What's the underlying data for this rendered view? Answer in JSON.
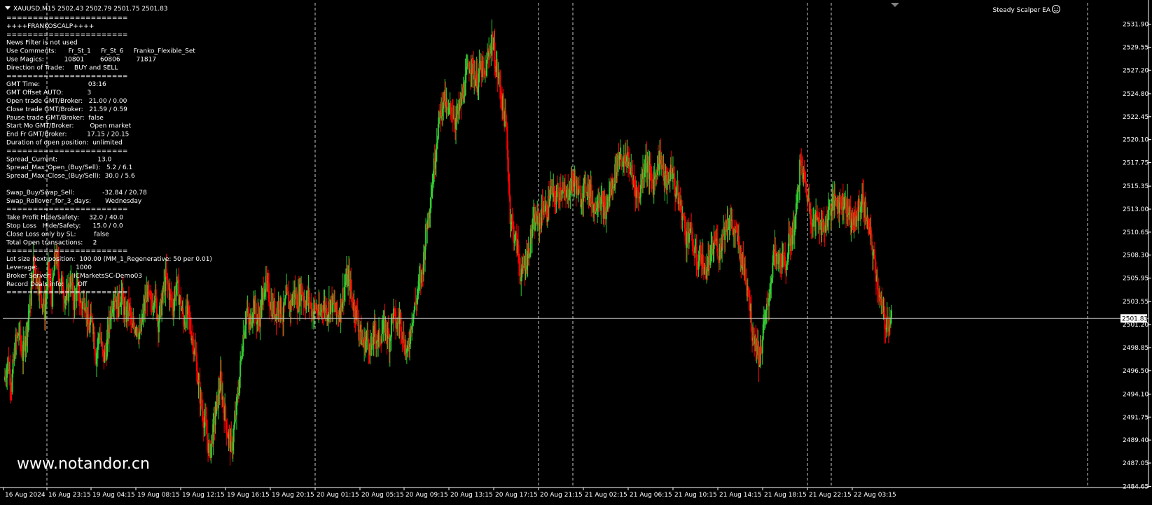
{
  "header": {
    "symbol_line": "XAUUSD,M15  2502.43 2502.79 2501.75 2501.83",
    "ea_name": "Steady Scalper EA",
    "ea_icon": "smiley-icon"
  },
  "info_panel": [
    "=======================",
    "++++FRANKOSCALP++++",
    "=======================",
    "News Filter is not used",
    "Use Comments:      Fr_St_1     Fr_St_6     Franko_Flexible_Set",
    "Use Magics:          10801        60806        71817",
    "Direction of Trade:     BUY and SELL",
    "=======================",
    "GMT Time:                        03:16",
    "GMT Offset AUTO:            3",
    "Open trade GMT/Broker:   21.00 / 0.00",
    "Close trade GMT/Broker:   21.59 / 0.59",
    "Pause trade GMT/Broker:  false",
    "Start Mo GMT/Broker:        Open market",
    "End Fr GMT/Broker:          17.15 / 20.15",
    "Duration of open position:  unlimited",
    "=======================",
    "Spread_Current:                    13.0",
    "Spread_Max_Open_(Buy/Sell):   5.2 / 6.1",
    "Spread_Max_Close_(Buy/Sell):  30.0 / 5.6",
    "",
    "Swap_Buy/Swap_Sell:              -32.84 / 20.78",
    "Swap_Rollover_for_3_days:       Wednesday",
    "=======================",
    "Take Profit Hide/Safety:     32.0 / 40.0",
    "Stop Loss   Hide/Safety:      15.0 / 0.0",
    "Close Loss only by SL:         false",
    "Total Open transactions:     2",
    "=======================",
    "Lot size next position:  100.00 (MM_1_Regenerative: 50 per 0.01)",
    "Leverage:                   1000",
    "Broker Server:           ICMarketsSC-Demo03",
    "Record Deals info:       Off",
    "======================="
  ],
  "watermark": "www.notandor.cn",
  "colors": {
    "background": "#000000",
    "bull": "#32CD32",
    "bear": "#FF0000",
    "grid": "#C0C0C0",
    "text": "#FFFFFF",
    "price_line": "#C0C0C0"
  },
  "chart_data": {
    "type": "candlestick",
    "symbol": "XAUUSD",
    "timeframe": "M15",
    "ylim": [
      2484.55,
      2532.8
    ],
    "price_ticks": [
      "2531.90",
      "2529.55",
      "2527.20",
      "2524.80",
      "2522.45",
      "2520.10",
      "2517.75",
      "2515.35",
      "2513.00",
      "2510.65",
      "2508.30",
      "2505.95",
      "2503.55",
      "2501.20",
      "2498.85",
      "2496.50",
      "2494.10",
      "2491.75",
      "2489.40",
      "2487.05",
      "2484.65"
    ],
    "current_price": "2501.83",
    "time_ticks": [
      "16 Aug 2024",
      "16 Aug 23:15",
      "19 Aug 04:15",
      "19 Aug 08:15",
      "19 Aug 12:15",
      "19 Aug 16:15",
      "19 Aug 20:15",
      "20 Aug 01:15",
      "20 Aug 05:15",
      "20 Aug 09:15",
      "20 Aug 13:15",
      "20 Aug 17:15",
      "20 Aug 21:15",
      "21 Aug 02:15",
      "21 Aug 06:15",
      "21 Aug 10:15",
      "21 Aug 14:15",
      "21 Aug 18:15",
      "21 Aug 22:15",
      "22 Aug 03:15"
    ],
    "day_separators": [
      "16 Aug 23:15",
      "20 Aug 01:15",
      "20 Aug 21:15",
      "21 Aug 22:15"
    ],
    "close_path": [
      [
        0,
        2495.5
      ],
      [
        5,
        2497.5
      ],
      [
        10,
        2495.0
      ],
      [
        15,
        2499.0
      ],
      [
        20,
        2500.5
      ],
      [
        25,
        2498.0
      ],
      [
        30,
        2500.5
      ],
      [
        35,
        2503.0
      ],
      [
        40,
        2507.5
      ],
      [
        45,
        2506.0
      ],
      [
        50,
        2504.5
      ],
      [
        55,
        2502.5
      ],
      [
        60,
        2506.5
      ],
      [
        65,
        2504.0
      ],
      [
        70,
        2508.5
      ],
      [
        75,
        2506.0
      ],
      [
        80,
        2505.0
      ],
      [
        85,
        2503.5
      ],
      [
        90,
        2506.0
      ],
      [
        95,
        2503.5
      ],
      [
        100,
        2505.0
      ],
      [
        105,
        2503.0
      ],
      [
        110,
        2504.0
      ],
      [
        115,
        2500.5
      ],
      [
        120,
        2502.0
      ],
      [
        125,
        2498.0
      ],
      [
        130,
        2500.5
      ],
      [
        135,
        2497.5
      ],
      [
        140,
        2499.0
      ],
      [
        145,
        2502.5
      ],
      [
        150,
        2504.5
      ],
      [
        155,
        2503.0
      ],
      [
        160,
        2504.5
      ],
      [
        165,
        2502.0
      ],
      [
        170,
        2503.0
      ],
      [
        175,
        2500.5
      ],
      [
        180,
        2501.5
      ],
      [
        185,
        2500.0
      ],
      [
        190,
        2502.5
      ],
      [
        195,
        2504.5
      ],
      [
        200,
        2503.0
      ],
      [
        205,
        2504.5
      ],
      [
        210,
        2501.5
      ],
      [
        215,
        2503.5
      ],
      [
        220,
        2506.0
      ],
      [
        225,
        2504.5
      ],
      [
        230,
        2503.0
      ],
      [
        235,
        2505.5
      ],
      [
        240,
        2503.5
      ],
      [
        245,
        2501.5
      ],
      [
        250,
        2502.5
      ],
      [
        255,
        2500.5
      ],
      [
        260,
        2498.5
      ],
      [
        265,
        2495.0
      ],
      [
        270,
        2492.5
      ],
      [
        275,
        2490.5
      ],
      [
        280,
        2488.0
      ],
      [
        285,
        2490.5
      ],
      [
        290,
        2493.0
      ],
      [
        295,
        2495.5
      ],
      [
        300,
        2492.5
      ],
      [
        305,
        2490.0
      ],
      [
        310,
        2488.5
      ],
      [
        315,
        2491.5
      ],
      [
        320,
        2495.0
      ],
      [
        325,
        2499.5
      ],
      [
        330,
        2502.5
      ],
      [
        335,
        2501.0
      ],
      [
        340,
        2503.5
      ],
      [
        345,
        2501.5
      ],
      [
        350,
        2502.5
      ],
      [
        355,
        2505.5
      ],
      [
        360,
        2504.5
      ],
      [
        365,
        2503.0
      ],
      [
        370,
        2502.5
      ],
      [
        375,
        2503.5
      ],
      [
        380,
        2502.0
      ],
      [
        385,
        2504.0
      ],
      [
        390,
        2503.0
      ],
      [
        395,
        2504.5
      ],
      [
        400,
        2503.5
      ],
      [
        405,
        2505.0
      ],
      [
        410,
        2503.5
      ],
      [
        415,
        2504.0
      ],
      [
        420,
        2502.5
      ],
      [
        425,
        2503.0
      ],
      [
        430,
        2502.0
      ],
      [
        435,
        2503.5
      ],
      [
        440,
        2502.5
      ],
      [
        445,
        2503.5
      ],
      [
        450,
        2503.0
      ],
      [
        455,
        2502.0
      ],
      [
        460,
        2503.5
      ],
      [
        465,
        2505.5
      ],
      [
        470,
        2506.0
      ],
      [
        475,
        2503.5
      ],
      [
        480,
        2502.5
      ],
      [
        485,
        2500.5
      ],
      [
        490,
        2499.0
      ],
      [
        495,
        2500.0
      ],
      [
        500,
        2498.5
      ],
      [
        505,
        2500.5
      ],
      [
        510,
        2499.5
      ],
      [
        515,
        2500.5
      ],
      [
        520,
        2501.0
      ],
      [
        525,
        2499.5
      ],
      [
        530,
        2502.5
      ],
      [
        535,
        2501.0
      ],
      [
        540,
        2502.0
      ],
      [
        545,
        2499.5
      ],
      [
        550,
        2498.0
      ],
      [
        555,
        2501.5
      ],
      [
        560,
        2503.0
      ],
      [
        565,
        2505.0
      ],
      [
        570,
        2506.5
      ],
      [
        575,
        2510.5
      ],
      [
        580,
        2513.5
      ],
      [
        585,
        2516.5
      ],
      [
        590,
        2520.5
      ],
      [
        595,
        2523.0
      ],
      [
        600,
        2524.5
      ],
      [
        605,
        2522.5
      ],
      [
        610,
        2523.5
      ],
      [
        615,
        2522.0
      ],
      [
        620,
        2523.0
      ],
      [
        625,
        2524.5
      ],
      [
        630,
        2526.5
      ],
      [
        635,
        2528.0
      ],
      [
        640,
        2527.0
      ],
      [
        645,
        2526.0
      ],
      [
        650,
        2527.5
      ],
      [
        655,
        2526.5
      ],
      [
        660,
        2528.5
      ],
      [
        665,
        2530.5
      ],
      [
        670,
        2528.0
      ],
      [
        675,
        2526.0
      ],
      [
        680,
        2523.5
      ],
      [
        685,
        2521.0
      ],
      [
        690,
        2512.5
      ],
      [
        695,
        2510.5
      ],
      [
        700,
        2509.0
      ],
      [
        705,
        2506.0
      ],
      [
        710,
        2507.5
      ],
      [
        715,
        2508.5
      ],
      [
        720,
        2511.0
      ],
      [
        725,
        2512.0
      ],
      [
        730,
        2511.5
      ],
      [
        735,
        2513.5
      ],
      [
        740,
        2512.5
      ],
      [
        745,
        2515.0
      ],
      [
        750,
        2514.0
      ],
      [
        755,
        2514.5
      ],
      [
        760,
        2515.5
      ],
      [
        765,
        2514.0
      ],
      [
        770,
        2515.0
      ],
      [
        775,
        2516.0
      ],
      [
        780,
        2515.5
      ],
      [
        785,
        2514.0
      ],
      [
        790,
        2515.0
      ],
      [
        795,
        2515.5
      ],
      [
        800,
        2514.5
      ],
      [
        805,
        2513.0
      ],
      [
        810,
        2514.5
      ],
      [
        815,
        2513.5
      ],
      [
        820,
        2512.5
      ],
      [
        825,
        2514.5
      ],
      [
        830,
        2515.5
      ],
      [
        835,
        2517.5
      ],
      [
        840,
        2519.0
      ],
      [
        845,
        2517.5
      ],
      [
        850,
        2518.5
      ],
      [
        855,
        2516.5
      ],
      [
        860,
        2515.5
      ],
      [
        865,
        2514.0
      ],
      [
        870,
        2516.5
      ],
      [
        875,
        2518.0
      ],
      [
        880,
        2516.5
      ],
      [
        885,
        2515.5
      ],
      [
        890,
        2517.5
      ],
      [
        895,
        2518.5
      ],
      [
        900,
        2516.0
      ],
      [
        905,
        2515.5
      ],
      [
        910,
        2517.5
      ],
      [
        915,
        2515.0
      ],
      [
        920,
        2514.0
      ],
      [
        925,
        2512.5
      ],
      [
        930,
        2510.0
      ],
      [
        935,
        2511.0
      ],
      [
        940,
        2509.0
      ],
      [
        945,
        2507.5
      ],
      [
        950,
        2508.5
      ],
      [
        955,
        2506.5
      ],
      [
        960,
        2507.5
      ],
      [
        965,
        2508.5
      ],
      [
        970,
        2510.0
      ],
      [
        975,
        2508.5
      ],
      [
        980,
        2510.5
      ],
      [
        985,
        2511.5
      ],
      [
        990,
        2512.0
      ],
      [
        995,
        2510.5
      ],
      [
        1000,
        2510.0
      ],
      [
        1005,
        2508.0
      ],
      [
        1010,
        2506.5
      ],
      [
        1015,
        2505.0
      ],
      [
        1020,
        2500.5
      ],
      [
        1025,
        2499.5
      ],
      [
        1030,
        2497.5
      ],
      [
        1035,
        2500.5
      ],
      [
        1040,
        2502.5
      ],
      [
        1045,
        2505.5
      ],
      [
        1050,
        2508.5
      ],
      [
        1055,
        2507.5
      ],
      [
        1060,
        2508.0
      ],
      [
        1065,
        2507.0
      ],
      [
        1070,
        2509.5
      ],
      [
        1075,
        2510.5
      ],
      [
        1080,
        2512.5
      ],
      [
        1085,
        2517.5
      ],
      [
        1090,
        2516.5
      ],
      [
        1095,
        2514.5
      ],
      [
        1100,
        2512.5
      ],
      [
        1105,
        2511.5
      ],
      [
        1110,
        2512.5
      ],
      [
        1115,
        2511.0
      ],
      [
        1120,
        2511.5
      ],
      [
        1125,
        2513.0
      ],
      [
        1130,
        2513.5
      ],
      [
        1135,
        2514.0
      ],
      [
        1140,
        2513.5
      ],
      [
        1145,
        2514.0
      ],
      [
        1150,
        2513.0
      ],
      [
        1155,
        2512.0
      ],
      [
        1160,
        2511.5
      ],
      [
        1165,
        2513.0
      ],
      [
        1170,
        2514.0
      ],
      [
        1175,
        2512.5
      ],
      [
        1180,
        2510.5
      ],
      [
        1185,
        2508.5
      ],
      [
        1190,
        2506.0
      ],
      [
        1195,
        2503.5
      ],
      [
        1200,
        2501.5
      ],
      [
        1205,
        2501.5
      ],
      [
        1210,
        2501.83
      ]
    ]
  }
}
